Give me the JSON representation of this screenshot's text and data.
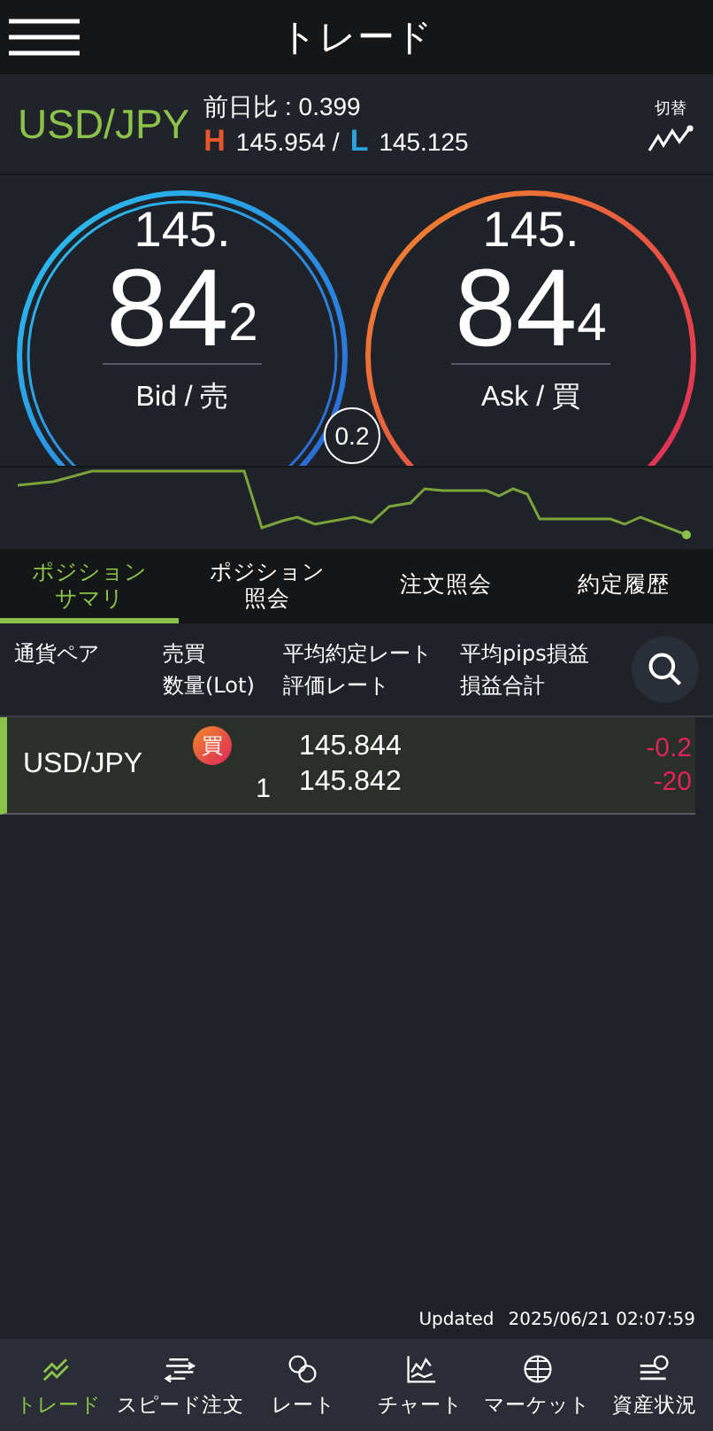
{
  "header": {
    "title": "トレード"
  },
  "quote": {
    "pair": "USD/JPY",
    "change": "前日比 : 0.399",
    "high_label": "H",
    "high": "145.954 /",
    "low_label": "L",
    "low": "145.125",
    "switch_label": "切替"
  },
  "prices": [
    {
      "kind": "bid",
      "head": "145.",
      "main": "84",
      "pip": "2",
      "label": "Bid / 売"
    },
    {
      "kind": "ask",
      "head": "145.",
      "main": "84",
      "pip": "4",
      "label": "Ask / 買"
    }
  ],
  "spread": "0.2",
  "tabs": [
    {
      "label": "ポジションサマリ",
      "selected": true
    },
    {
      "label": "ポジション照会",
      "selected": false
    },
    {
      "label": "注文照会",
      "selected": false
    },
    {
      "label": "約定履歴",
      "selected": false
    }
  ],
  "columns": [
    [
      "通貨ペア"
    ],
    [
      "売買",
      "数量(Lot)"
    ],
    [
      "平均約定レート",
      "評価レート"
    ],
    [
      "平均pips損益",
      "損益合計"
    ]
  ],
  "positions": [
    {
      "pair": "USD/JPY",
      "side": "買",
      "lots": "1",
      "avg_rate": "145.844",
      "eval_rate": "145.842",
      "avg_pips": "-0.2",
      "total": "-20"
    }
  ],
  "updated": {
    "label": "Updated",
    "time": "2025/06/21  02:07:59"
  },
  "nav": [
    {
      "kind": "trade",
      "label": "トレード",
      "selected": true
    },
    {
      "kind": "speed",
      "label": "スピード注文",
      "selected": false
    },
    {
      "kind": "rate",
      "label": "レート",
      "selected": false
    },
    {
      "kind": "chart",
      "label": "チャート",
      "selected": false
    },
    {
      "kind": "market",
      "label": "マーケット",
      "selected": false
    },
    {
      "kind": "assets",
      "label": "資産状況",
      "selected": false
    }
  ]
}
